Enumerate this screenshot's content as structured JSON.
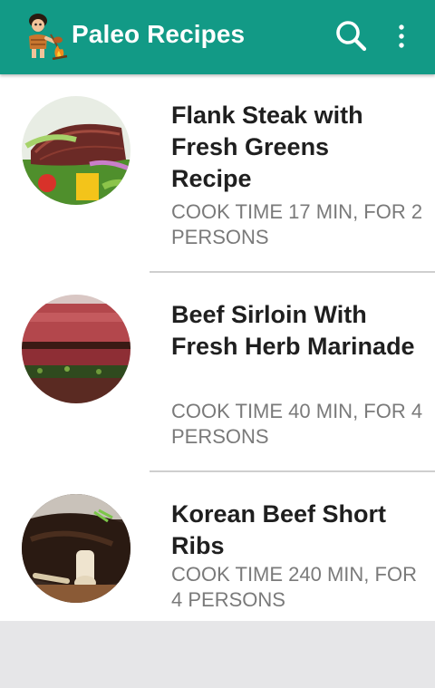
{
  "app": {
    "title": "Paleo Recipes",
    "logo_icon": "caveman-cooking-icon",
    "accent_color": "#129a86"
  },
  "toolbar": {
    "search_icon": "search-icon",
    "more_icon": "more-vert-icon"
  },
  "recipes": [
    {
      "title": "Flank Steak with Fresh Greens Recipe",
      "meta": "COOK TIME 17 MIN, FOR 2 PERSONS",
      "image_icon": "flank-steak-photo"
    },
    {
      "title": "Beef Sirloin With Fresh Herb Marinade",
      "meta": "COOK TIME 40 MIN, FOR 4 PERSONS",
      "image_icon": "beef-sirloin-photo"
    },
    {
      "title": "Korean Beef Short Ribs",
      "meta": "COOK TIME 240 MIN, FOR 4 PERSONS",
      "image_icon": "short-ribs-photo"
    }
  ]
}
